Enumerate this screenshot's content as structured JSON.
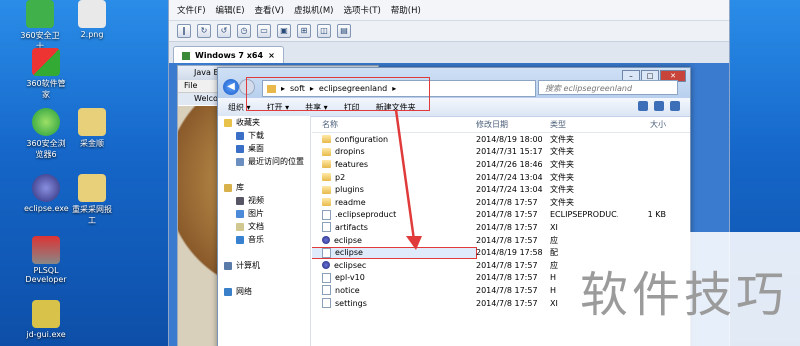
{
  "desktop_icons": [
    {
      "label": "360安全卫士",
      "x": "d1"
    },
    {
      "label": "2.png",
      "x": "d2"
    },
    {
      "label": "360软件管家"
    },
    {
      "label": "360安全浏览器6"
    },
    {
      "label": "采金顺"
    },
    {
      "label": "eclipse.exe"
    },
    {
      "label": "重采采网报工"
    },
    {
      "label": "PLSQL Developer"
    },
    {
      "label": "jd-gui.exe"
    }
  ],
  "vm": {
    "menu": [
      "文件(F)",
      "编辑(E)",
      "查看(V)",
      "虚拟机(M)",
      "选项卡(T)",
      "帮助(H)"
    ],
    "tab_label": "Windows 7 x64"
  },
  "java_window": {
    "title": "Java E",
    "menu": "File",
    "welcome": "Welco"
  },
  "explorer": {
    "breadcrumb": [
      "soft",
      "eclipsegreenland"
    ],
    "search_placeholder": "搜索 eclipsegreenland",
    "commands": [
      "组织 ▾",
      "打开 ▾",
      "共享 ▾",
      "打印",
      "新建文件夹"
    ],
    "nav": [
      {
        "label": "收藏夹",
        "sub": false,
        "color": "#e8c24a"
      },
      {
        "label": "下载",
        "sub": true,
        "color": "#3a6fc8"
      },
      {
        "label": "桌面",
        "sub": true,
        "color": "#3a6fc8"
      },
      {
        "label": "最近访问的位置",
        "sub": true,
        "color": "#6a8fc0"
      },
      {
        "label": "",
        "sub": false,
        "color": "transparent"
      },
      {
        "label": "库",
        "sub": false,
        "color": "#d8b14a"
      },
      {
        "label": "视频",
        "sub": true,
        "color": "#556"
      },
      {
        "label": "图片",
        "sub": true,
        "color": "#4a8ad8"
      },
      {
        "label": "文档",
        "sub": true,
        "color": "#d0c890"
      },
      {
        "label": "音乐",
        "sub": true,
        "color": "#3a80d0"
      },
      {
        "label": "",
        "sub": false,
        "color": "transparent"
      },
      {
        "label": "计算机",
        "sub": false,
        "color": "#5a7aa8"
      },
      {
        "label": "",
        "sub": false,
        "color": "transparent"
      },
      {
        "label": "网络",
        "sub": false,
        "color": "#3a80c8"
      }
    ],
    "columns": {
      "name": "名称",
      "date": "修改日期",
      "type": "类型",
      "size": "大小"
    },
    "files": [
      {
        "name": "configuration",
        "date": "2014/8/19 18:00",
        "type": "文件夹",
        "size": "",
        "icon": "folder"
      },
      {
        "name": "dropins",
        "date": "2014/7/31 15:17",
        "type": "文件夹",
        "size": "",
        "icon": "folder"
      },
      {
        "name": "features",
        "date": "2014/7/26 18:46",
        "type": "文件夹",
        "size": "",
        "icon": "folder"
      },
      {
        "name": "p2",
        "date": "2014/7/24 13:04",
        "type": "文件夹",
        "size": "",
        "icon": "folder"
      },
      {
        "name": "plugins",
        "date": "2014/7/24 13:04",
        "type": "文件夹",
        "size": "",
        "icon": "folder"
      },
      {
        "name": "readme",
        "date": "2014/7/8 17:57",
        "type": "文件夹",
        "size": "",
        "icon": "folder"
      },
      {
        "name": ".eclipseproduct",
        "date": "2014/7/8 17:57",
        "type": "ECLIPSEPRODUC...",
        "size": "1 KB",
        "icon": "file"
      },
      {
        "name": "artifacts",
        "date": "2014/7/8 17:57",
        "type": "XI",
        "size": "",
        "icon": "file"
      },
      {
        "name": "eclipse",
        "date": "2014/7/8 17:57",
        "type": "应",
        "size": "",
        "icon": "exe"
      },
      {
        "name": "eclipse",
        "date": "2014/8/19 17:58",
        "type": "配",
        "size": "",
        "icon": "file",
        "highlight": true
      },
      {
        "name": "eclipsec",
        "date": "2014/7/8 17:57",
        "type": "应",
        "size": "",
        "icon": "exe"
      },
      {
        "name": "epl-v10",
        "date": "2014/7/8 17:57",
        "type": "H",
        "size": "",
        "icon": "file"
      },
      {
        "name": "notice",
        "date": "2014/7/8 17:57",
        "type": "H",
        "size": "",
        "icon": "file"
      },
      {
        "name": "settings",
        "date": "2014/7/8 17:57",
        "type": "XI",
        "size": "",
        "icon": "file"
      }
    ]
  },
  "watermark": "软件技巧",
  "colors": {
    "annotation": "#e03a3a"
  }
}
